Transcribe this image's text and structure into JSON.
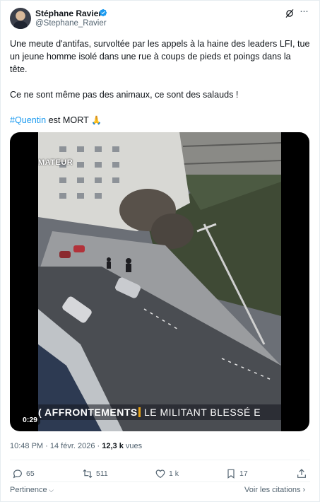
{
  "author": {
    "name": "Stéphane Ravier",
    "handle": "@Stephane_Ravier"
  },
  "icons": {
    "verified": "verified-badge-icon",
    "grok": "grok-icon",
    "more": "more-options-icon",
    "reply": "reply-icon",
    "repost": "repost-icon",
    "like": "like-icon",
    "bookmark": "bookmark-icon",
    "share": "share-icon"
  },
  "colors": {
    "accent": "#1d9bf0",
    "verified": "#1d9bf0",
    "text": "#0f1419",
    "muted": "#536471",
    "banner_accent": "#e8a317"
  },
  "tweet": {
    "paragraph1": "Une meute d'antifas, survoltée par les appels à la haine des leaders LFI, tue un jeune homme isolé dans une rue à coups de pieds et poings dans la tête.",
    "paragraph2": "Ce ne sont même pas des animaux, ce sont des salauds !",
    "hashtag": "#Quentin",
    "paragraph3_rest": " est MORT ",
    "emoji": "🙏"
  },
  "media": {
    "tag": "MATEUR",
    "lower_third_bold": "( AFFRONTEMENTS",
    "lower_third_text": "LE MILITANT BLESSÉ E",
    "duration": "0:29"
  },
  "meta": {
    "time": "10:48 PM",
    "separator": " · ",
    "date": "14 févr. 2026",
    "dot": " · ",
    "views_count": "12,3 k",
    "views_label": " vues"
  },
  "actions": {
    "replies": "65",
    "reposts": "511",
    "likes": "1 k",
    "bookmarks": "17"
  },
  "footer": {
    "sort_label": "Pertinence",
    "quotes_label": "Voir les citations"
  }
}
